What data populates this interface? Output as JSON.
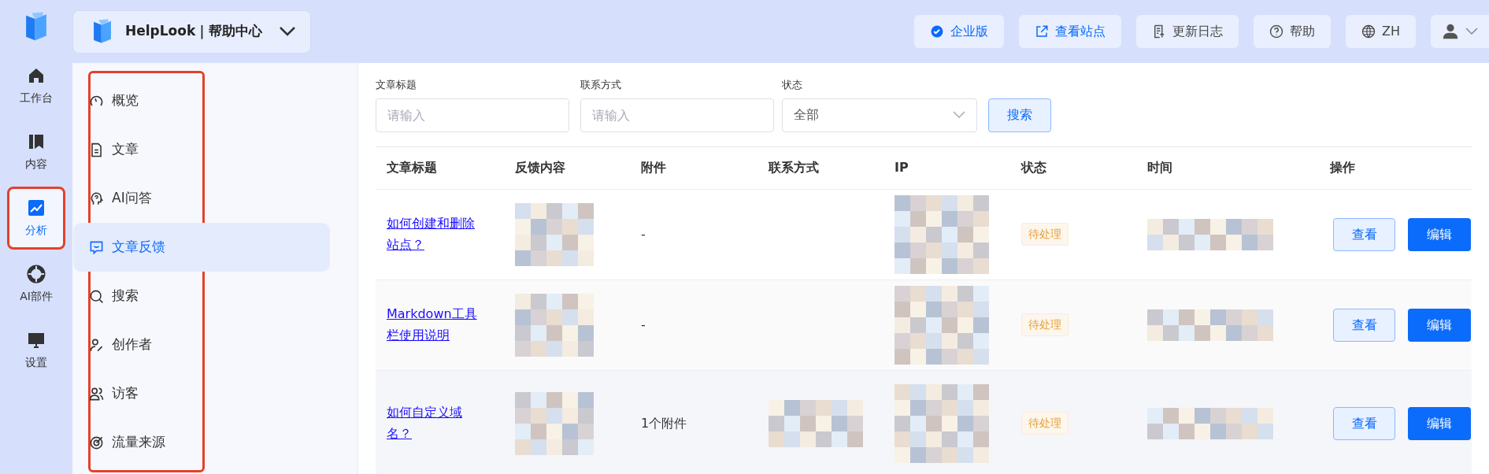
{
  "rail": [
    {
      "label": "工作台",
      "selected": false,
      "highlighted": false
    },
    {
      "label": "内容",
      "selected": false,
      "highlighted": false
    },
    {
      "label": "分析",
      "selected": true,
      "highlighted": true
    },
    {
      "label": "AI部件",
      "selected": false,
      "highlighted": false
    },
    {
      "label": "设置",
      "selected": false,
      "highlighted": false
    }
  ],
  "brand": {
    "name": "HelpLook｜帮助中心"
  },
  "top_actions": [
    {
      "label": "企业版",
      "kind": "primary"
    },
    {
      "label": "查看站点",
      "kind": "primary"
    },
    {
      "label": "更新日志",
      "kind": "plain"
    },
    {
      "label": "帮助",
      "kind": "plain"
    },
    {
      "label": "ZH",
      "kind": "plain"
    },
    {
      "kind": "menu"
    }
  ],
  "subnav": {
    "highlighted": true,
    "items": [
      {
        "label": "概览",
        "selected": false
      },
      {
        "label": "文章",
        "selected": false
      },
      {
        "label": "AI问答",
        "selected": false
      },
      {
        "label": "文章反馈",
        "selected": true
      },
      {
        "label": "搜索",
        "selected": false
      },
      {
        "label": "创作者",
        "selected": false
      },
      {
        "label": "访客",
        "selected": false
      },
      {
        "label": "流量来源",
        "selected": false
      }
    ]
  },
  "filters": [
    {
      "label": "文章标题",
      "placeholder": "请输入"
    },
    {
      "label": "联系方式",
      "placeholder": "请输入"
    }
  ],
  "status_filter": {
    "label": "状态",
    "value": "全部"
  },
  "search_button": "搜索",
  "table": {
    "columns": [
      "文章标题",
      "反馈内容",
      "附件",
      "联系方式",
      "IP",
      "状态",
      "时间",
      "操作"
    ],
    "rows": [
      {
        "title": "如何创建和删除站点？",
        "attachment": "-",
        "status": "待处理",
        "actions": [
          "查看",
          "编辑"
        ]
      },
      {
        "title": "Markdown工具栏使用说明",
        "attachment": "-",
        "status": "待处理",
        "actions": [
          "查看",
          "编辑"
        ]
      },
      {
        "title": "如何自定义域名？",
        "attachment": "1个附件",
        "status": "待处理",
        "actions": [
          "查看",
          "编辑"
        ]
      }
    ]
  }
}
